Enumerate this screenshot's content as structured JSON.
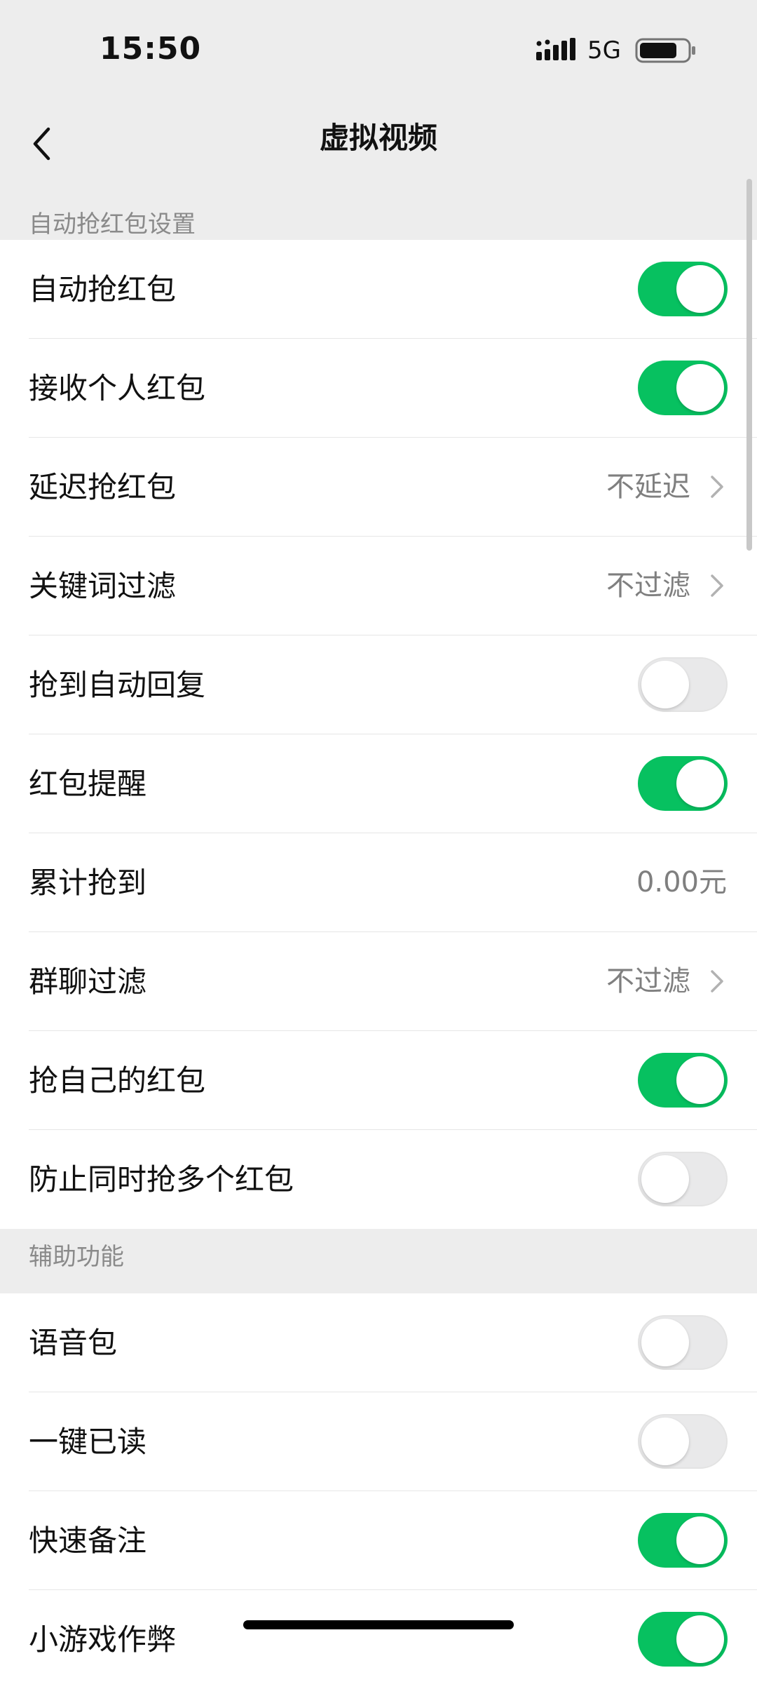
{
  "status_bar": {
    "time": "15:50",
    "network": "5G"
  },
  "nav": {
    "title": "虚拟视频",
    "back_icon": "chevron-left-icon"
  },
  "sections": [
    {
      "header": "自动抢红包设置",
      "rows": [
        {
          "label": "自动抢红包",
          "type": "toggle",
          "on": true
        },
        {
          "label": "接收个人红包",
          "type": "toggle",
          "on": true
        },
        {
          "label": "延迟抢红包",
          "type": "link",
          "value": "不延迟"
        },
        {
          "label": "关键词过滤",
          "type": "link",
          "value": "不过滤"
        },
        {
          "label": "抢到自动回复",
          "type": "toggle",
          "on": false
        },
        {
          "label": "红包提醒",
          "type": "toggle",
          "on": true
        },
        {
          "label": "累计抢到",
          "type": "value",
          "value": "0.00元"
        },
        {
          "label": "群聊过滤",
          "type": "link",
          "value": "不过滤"
        },
        {
          "label": "抢自己的红包",
          "type": "toggle",
          "on": true
        },
        {
          "label": "防止同时抢多个红包",
          "type": "toggle",
          "on": false
        }
      ]
    },
    {
      "header": "辅助功能",
      "rows": [
        {
          "label": "语音包",
          "type": "toggle",
          "on": false
        },
        {
          "label": "一键已读",
          "type": "toggle",
          "on": false
        },
        {
          "label": "快速备注",
          "type": "toggle",
          "on": true
        },
        {
          "label": "小游戏作弊",
          "type": "toggle",
          "on": true
        }
      ]
    }
  ],
  "colors": {
    "accent_green": "#07c160",
    "background": "#ededed"
  }
}
